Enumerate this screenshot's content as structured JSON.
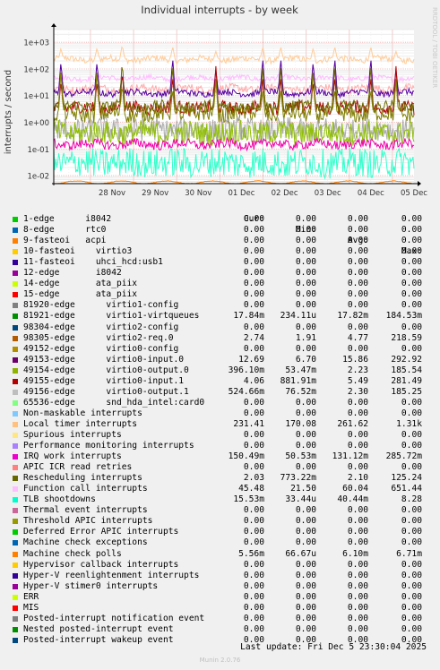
{
  "chart_data": {
    "type": "line",
    "title": "Individual interrupts - by week",
    "ylabel": "interrupts / second",
    "side_label": "RRDTOOL / TOBI OETIKER",
    "y_scale": "log",
    "ylim": [
      0.005,
      3000
    ],
    "y_ticks": [
      {
        "label": "1e+03",
        "value": 1000
      },
      {
        "label": "1e+02",
        "value": 100
      },
      {
        "label": "1e+01",
        "value": 10
      },
      {
        "label": "1e+00",
        "value": 1
      },
      {
        "label": "1e-01",
        "value": 0.1
      },
      {
        "label": "1e-02",
        "value": 0.01
      }
    ],
    "x_ticks": [
      "28 Nov",
      "29 Nov",
      "30 Nov",
      "01 Dec",
      "02 Dec",
      "03 Dec",
      "04 Dec",
      "05 Dec"
    ],
    "series": [
      {
        "name": "Local timer interrupts",
        "color": "#ffcc99",
        "base": 230,
        "noise": 0.12,
        "spike_top": 800
      },
      {
        "name": "Function call interrupts",
        "color": "#ffbbff",
        "base": 45,
        "noise": 0.1,
        "spike_top": 0
      },
      {
        "name": "virtio1-virtqueues",
        "color": "#ffaaaa",
        "base": 18,
        "noise": 0.15,
        "spike_top": 0
      },
      {
        "name": "virtio0-input.0",
        "color": "#55009d",
        "base": 12.7,
        "noise": 0.12,
        "spike_top": 260
      },
      {
        "name": "virtio2-req.0",
        "color": "#b00000",
        "base": 3.5,
        "noise": 0.25,
        "spike_top": 200
      },
      {
        "name": "virtio0-input.1",
        "color": "#6b6b00",
        "base": 4.0,
        "noise": 0.2,
        "spike_top": 220
      },
      {
        "name": "Rescheduling interrupts",
        "color": "#7f7f00",
        "base": 2.0,
        "noise": 0.3,
        "spike_top": 100
      },
      {
        "name": "virtio0-output.1",
        "color": "#aaaaaa",
        "base": 0.52,
        "noise": 0.45,
        "spike_top": 0
      },
      {
        "name": "virtio0-output.0",
        "color": "#8fbf00",
        "base": 0.4,
        "noise": 0.45,
        "spike_top": 0
      },
      {
        "name": "IRQ work interrupts",
        "color": "#ee00aa",
        "base": 0.15,
        "noise": 0.18,
        "spike_top": 0
      },
      {
        "name": "TLB shootdowns",
        "color": "#33ffcc",
        "base": 0.03,
        "noise": 0.55,
        "spike_top": 0
      },
      {
        "name": "Machine check polls",
        "color": "#ff8000",
        "base": 0.0056,
        "noise": 0.01,
        "spike_top": 0
      }
    ],
    "spike_positions": [
      0.02,
      0.12,
      0.19,
      0.33,
      0.45,
      0.58,
      0.63,
      0.72,
      0.78,
      0.88,
      0.95
    ]
  },
  "legend": {
    "headers": {
      "cur": "Cur:",
      "min": "Min:",
      "avg": "Avg:",
      "max": "Max:"
    },
    "rows": [
      {
        "name": "1-edge      i8042",
        "color": "#00cc00",
        "cur": "0.00",
        "min": "0.00",
        "avg": "0.00",
        "max": "0.00"
      },
      {
        "name": "8-edge      rtc0",
        "color": "#0066b3",
        "cur": "0.00",
        "min": "0.00",
        "avg": "0.00",
        "max": "0.00"
      },
      {
        "name": "9-fasteoi   acpi",
        "color": "#ff8000",
        "cur": "0.00",
        "min": "0.00",
        "avg": "0.00",
        "max": "0.00"
      },
      {
        "name": "10-fasteoi    virtio3",
        "color": "#ffcc00",
        "cur": "0.00",
        "min": "0.00",
        "avg": "0.00",
        "max": "0.00"
      },
      {
        "name": "11-fasteoi    uhci_hcd:usb1",
        "color": "#330099",
        "cur": "0.00",
        "min": "0.00",
        "avg": "0.00",
        "max": "0.00"
      },
      {
        "name": "12-edge       i8042",
        "color": "#990099",
        "cur": "0.00",
        "min": "0.00",
        "avg": "0.00",
        "max": "0.00"
      },
      {
        "name": "14-edge       ata_piix",
        "color": "#ccff00",
        "cur": "0.00",
        "min": "0.00",
        "avg": "0.00",
        "max": "0.00"
      },
      {
        "name": "15-edge       ata_piix",
        "color": "#ff0000",
        "cur": "0.00",
        "min": "0.00",
        "avg": "0.00",
        "max": "0.00"
      },
      {
        "name": "81920-edge      virtio1-config",
        "color": "#808080",
        "cur": "0.00",
        "min": "0.00",
        "avg": "0.00",
        "max": "0.00"
      },
      {
        "name": "81921-edge      virtio1-virtqueues",
        "color": "#008f00",
        "cur": "17.84m",
        "min": "234.11u",
        "avg": "17.82m",
        "max": "184.53m"
      },
      {
        "name": "98304-edge      virtio2-config",
        "color": "#00487d",
        "cur": "0.00",
        "min": "0.00",
        "avg": "0.00",
        "max": "0.00"
      },
      {
        "name": "98305-edge      virtio2-req.0",
        "color": "#b35a00",
        "cur": "2.74",
        "min": "1.91",
        "avg": "4.77",
        "max": "218.59"
      },
      {
        "name": "49152-edge      virtio0-config",
        "color": "#b38f00",
        "cur": "0.00",
        "min": "0.00",
        "avg": "0.00",
        "max": "0.00"
      },
      {
        "name": "49153-edge      virtio0-input.0",
        "color": "#6b006b",
        "cur": "12.69",
        "min": "6.70",
        "avg": "15.86",
        "max": "292.92"
      },
      {
        "name": "49154-edge      virtio0-output.0",
        "color": "#8fb300",
        "cur": "396.10m",
        "min": "53.47m",
        "avg": "2.23",
        "max": "185.54"
      },
      {
        "name": "49155-edge      virtio0-input.1",
        "color": "#b30000",
        "cur": "4.06",
        "min": "881.91m",
        "avg": "5.49",
        "max": "281.49"
      },
      {
        "name": "49156-edge      virtio0-output.1",
        "color": "#bebebe",
        "cur": "524.66m",
        "min": "76.52m",
        "avg": "2.30",
        "max": "185.25"
      },
      {
        "name": "65536-edge      snd_hda_intel:card0",
        "color": "#80ff80",
        "cur": "0.00",
        "min": "0.00",
        "avg": "0.00",
        "max": "0.00"
      },
      {
        "name": "Non-maskable interrupts",
        "color": "#80c9ff",
        "cur": "0.00",
        "min": "0.00",
        "avg": "0.00",
        "max": "0.00"
      },
      {
        "name": "Local timer interrupts",
        "color": "#ffc080",
        "cur": "231.41",
        "min": "170.08",
        "avg": "261.62",
        "max": "1.31k"
      },
      {
        "name": "Spurious interrupts",
        "color": "#ffe680",
        "cur": "0.00",
        "min": "0.00",
        "avg": "0.00",
        "max": "0.00"
      },
      {
        "name": "Performance monitoring interrupts",
        "color": "#aa80ff",
        "cur": "0.00",
        "min": "0.00",
        "avg": "0.00",
        "max": "0.00"
      },
      {
        "name": "IRQ work interrupts",
        "color": "#ee00cc",
        "cur": "150.49m",
        "min": "50.53m",
        "avg": "131.12m",
        "max": "285.72m"
      },
      {
        "name": "APIC ICR read retries",
        "color": "#ff8080",
        "cur": "0.00",
        "min": "0.00",
        "avg": "0.00",
        "max": "0.00"
      },
      {
        "name": "Rescheduling interrupts",
        "color": "#666600",
        "cur": "2.03",
        "min": "773.22m",
        "avg": "2.10",
        "max": "125.24"
      },
      {
        "name": "Function call interrupts",
        "color": "#ffbfff",
        "cur": "45.48",
        "min": "21.50",
        "avg": "60.04",
        "max": "651.44"
      },
      {
        "name": "TLB shootdowns",
        "color": "#00ffcc",
        "cur": "15.53m",
        "min": "33.44u",
        "avg": "40.44m",
        "max": "8.28"
      },
      {
        "name": "Thermal event interrupts",
        "color": "#cc6699",
        "cur": "0.00",
        "min": "0.00",
        "avg": "0.00",
        "max": "0.00"
      },
      {
        "name": "Threshold APIC interrupts",
        "color": "#999900",
        "cur": "0.00",
        "min": "0.00",
        "avg": "0.00",
        "max": "0.00"
      },
      {
        "name": "Deferred Error APIC interrupts",
        "color": "#00cc00",
        "cur": "0.00",
        "min": "0.00",
        "avg": "0.00",
        "max": "0.00"
      },
      {
        "name": "Machine check exceptions",
        "color": "#0066b3",
        "cur": "0.00",
        "min": "0.00",
        "avg": "0.00",
        "max": "0.00"
      },
      {
        "name": "Machine check polls",
        "color": "#ff8000",
        "cur": "5.56m",
        "min": "66.67u",
        "avg": "6.10m",
        "max": "6.71m"
      },
      {
        "name": "Hypervisor callback interrupts",
        "color": "#ffcc00",
        "cur": "0.00",
        "min": "0.00",
        "avg": "0.00",
        "max": "0.00"
      },
      {
        "name": "Hyper-V reenlightenment interrupts",
        "color": "#330099",
        "cur": "0.00",
        "min": "0.00",
        "avg": "0.00",
        "max": "0.00"
      },
      {
        "name": "Hyper-V stimer0 interrupts",
        "color": "#990099",
        "cur": "0.00",
        "min": "0.00",
        "avg": "0.00",
        "max": "0.00"
      },
      {
        "name": "ERR",
        "color": "#ccff00",
        "cur": "0.00",
        "min": "0.00",
        "avg": "0.00",
        "max": "0.00"
      },
      {
        "name": "MIS",
        "color": "#ff0000",
        "cur": "0.00",
        "min": "0.00",
        "avg": "0.00",
        "max": "0.00"
      },
      {
        "name": "Posted-interrupt notification event",
        "color": "#808080",
        "cur": "0.00",
        "min": "0.00",
        "avg": "0.00",
        "max": "0.00"
      },
      {
        "name": "Nested posted-interrupt event",
        "color": "#008f00",
        "cur": "0.00",
        "min": "0.00",
        "avg": "0.00",
        "max": "0.00"
      },
      {
        "name": "Posted-interrupt wakeup event",
        "color": "#00487d",
        "cur": "0.00",
        "min": "0.00",
        "avg": "0.00",
        "max": "0.00"
      }
    ]
  },
  "footer": {
    "last_update": "Last update: Fri Dec  5 23:30:04 2025",
    "munin": "Munin 2.0.76"
  }
}
